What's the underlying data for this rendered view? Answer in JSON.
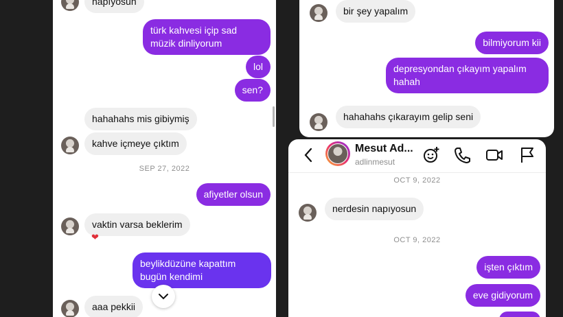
{
  "left": {
    "messages": [
      {
        "text": "napıyosun"
      },
      {
        "text": "türk kahvesi içip sad müzik dinliyorum"
      },
      {
        "text": "lol"
      },
      {
        "text": "sen?"
      },
      {
        "text": "hahahahs mis gibiymiş"
      },
      {
        "text": "kahve içmeye çıktım"
      },
      {
        "text": "afiyetler olsun"
      },
      {
        "text": "vaktin varsa beklerim"
      },
      {
        "text": "beylikdüzüne kapattım bugün kendimi"
      },
      {
        "text": "aaa pekkii"
      }
    ],
    "date": "SEP 27, 2022"
  },
  "right_top": {
    "messages": [
      {
        "text": "bir şey yapalım"
      },
      {
        "text": "bilmiyorum kii"
      },
      {
        "text": "depresyondan çıkayım yapalım hahah"
      },
      {
        "text": "hahahahs çıkarayım gelip seni"
      }
    ]
  },
  "right_bottom": {
    "header": {
      "name": "Mesut Ad...",
      "username": "adlinmesut"
    },
    "dates": [
      "OCT 9, 2022",
      "OCT 9, 2022"
    ],
    "messages": [
      {
        "text": "nerdesin napıyosun"
      },
      {
        "text": "işten çıktım"
      },
      {
        "text": "eve gidiyorum"
      }
    ]
  },
  "colors": {
    "outgoing": "#8a2ce2",
    "outgoing_blue": "#6a33ee",
    "incoming": "#efefef",
    "heart": "#e0303a"
  },
  "icons": [
    "back-icon",
    "effects-icon",
    "phone-icon",
    "video-icon",
    "flag-icon",
    "heart-icon",
    "chevron-down-icon"
  ]
}
